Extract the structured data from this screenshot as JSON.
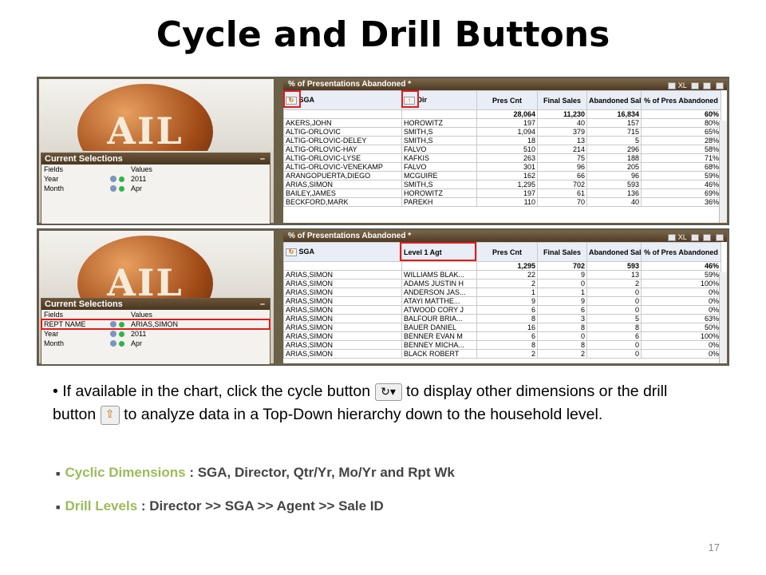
{
  "slide": {
    "title": "Cycle and Drill Buttons",
    "page_number": "17"
  },
  "logo_text": "AIL",
  "panel1": {
    "current_selections": {
      "title": "Current Selections",
      "minimize": "–",
      "header": {
        "field": "Fields",
        "value": "Values"
      },
      "rows": [
        {
          "field": "Year",
          "value": "2011"
        },
        {
          "field": "Month",
          "value": "Apr"
        }
      ]
    },
    "table": {
      "title": "% of Presentations Abandoned *",
      "tools": "XL",
      "columns": [
        "SGA",
        "Dir",
        "Pres Cnt",
        "Final Sales",
        "Abandoned Sales",
        "% of Pres Abandoned"
      ],
      "totals": [
        "",
        "",
        "28,064",
        "11,230",
        "16,834",
        "60%"
      ],
      "rows": [
        [
          "AKERS,JOHN",
          "HOROWITZ",
          "197",
          "40",
          "157",
          "80%"
        ],
        [
          "ALTIG-ORLOVIC",
          "SMITH,S",
          "1,094",
          "379",
          "715",
          "65%"
        ],
        [
          "ALTIG-ORLOVIC-DELEY",
          "SMITH,S",
          "18",
          "13",
          "5",
          "28%"
        ],
        [
          "ALTIG-ORLOVIC-HAY",
          "FALVO",
          "510",
          "214",
          "296",
          "58%"
        ],
        [
          "ALTIG-ORLOVIC-LYSE",
          "KAFKIS",
          "263",
          "75",
          "188",
          "71%"
        ],
        [
          "ALTIG-ORLOVIC-VENEKAMP",
          "FALVO",
          "301",
          "96",
          "205",
          "68%"
        ],
        [
          "ARANGOPUERTA,DIEGO",
          "MCGUIRE",
          "162",
          "66",
          "96",
          "59%"
        ],
        [
          "ARIAS,SIMON",
          "SMITH,S",
          "1,295",
          "702",
          "593",
          "46%"
        ],
        [
          "BAILEY,JAMES",
          "HOROWITZ",
          "197",
          "61",
          "136",
          "69%"
        ],
        [
          "BECKFORD,MARK",
          "PAREKH",
          "110",
          "70",
          "40",
          "36%"
        ]
      ]
    }
  },
  "panel2": {
    "current_selections": {
      "title": "Current Selections",
      "minimize": "–",
      "header": {
        "field": "Fields",
        "value": "Values"
      },
      "rows": [
        {
          "field": "REPT NAME",
          "value": "ARIAS,SIMON"
        },
        {
          "field": "Year",
          "value": "2011"
        },
        {
          "field": "Month",
          "value": "Apr"
        }
      ]
    },
    "table": {
      "title": "% of Presentations Abandoned *",
      "tools": "XL",
      "columns": [
        "SGA",
        "Level 1 Agt",
        "Pres Cnt",
        "Final Sales",
        "Abandoned Sales",
        "% of Pres Abandoned"
      ],
      "totals": [
        "",
        "",
        "1,295",
        "702",
        "593",
        "46%"
      ],
      "rows": [
        [
          "ARIAS,SIMON",
          "WILLIAMS BLAK...",
          "22",
          "9",
          "13",
          "59%"
        ],
        [
          "ARIAS,SIMON",
          "ADAMS JUSTIN H",
          "2",
          "0",
          "2",
          "100%"
        ],
        [
          "ARIAS,SIMON",
          "ANDERSON JAS...",
          "1",
          "1",
          "0",
          "0%"
        ],
        [
          "ARIAS,SIMON",
          "ATAYI MATTHE...",
          "9",
          "9",
          "0",
          "0%"
        ],
        [
          "ARIAS,SIMON",
          "ATWOOD CORY J",
          "6",
          "6",
          "0",
          "0%"
        ],
        [
          "ARIAS,SIMON",
          "BALFOUR BRIA...",
          "8",
          "3",
          "5",
          "63%"
        ],
        [
          "ARIAS,SIMON",
          "BAUER DANIEL",
          "16",
          "8",
          "8",
          "50%"
        ],
        [
          "ARIAS,SIMON",
          "BENNER EVAN M",
          "6",
          "0",
          "6",
          "100%"
        ],
        [
          "ARIAS,SIMON",
          "BENNEY MICHA...",
          "8",
          "8",
          "0",
          "0%"
        ],
        [
          "ARIAS,SIMON",
          "BLACK ROBERT",
          "2",
          "2",
          "0",
          "0%"
        ]
      ]
    }
  },
  "text": {
    "bullet_part1": "If available in the chart, click the cycle button",
    "bullet_part2": "to display other dimensions or the drill button",
    "bullet_part3": "to analyze data in a Top-Down hierarchy down to the household level.",
    "cyclic_key": "Cyclic Dimensions",
    "cyclic_sep": " : ",
    "cyclic_value": "SGA, Director, Qtr/Yr, Mo/Yr and Rpt Wk",
    "drill_key": "Drill Levels",
    "drill_sep": " : ",
    "drill_value": "Director >> SGA >> Agent >> Sale ID"
  },
  "icons": {
    "cycle": "cycle-icon",
    "drill": "drill-up-arrow-icon"
  },
  "colors": {
    "highlight_box": "#e21b1b",
    "key_text": "#9bbb59",
    "panel_header": "#4e3a24"
  }
}
